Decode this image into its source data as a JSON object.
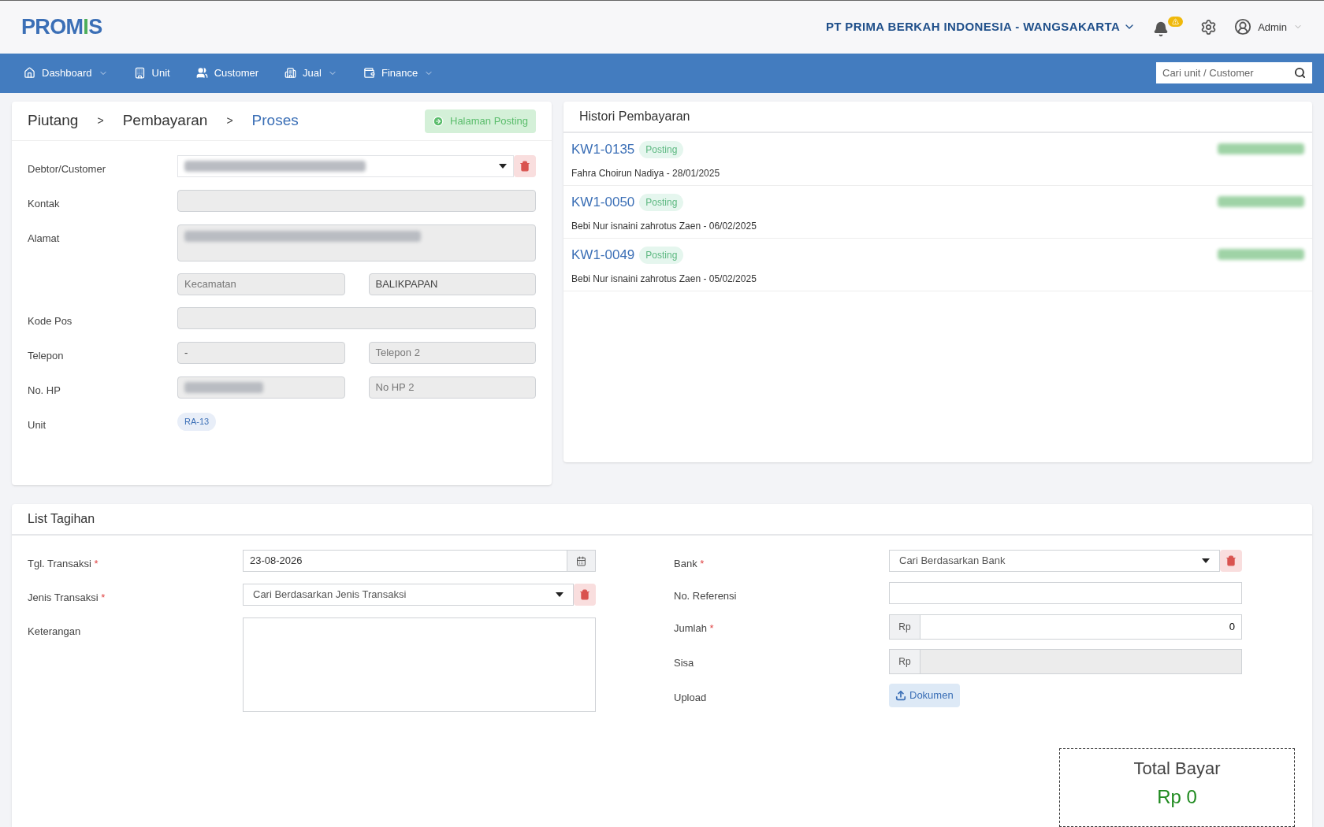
{
  "logo": {
    "segments": [
      {
        "text": "PROM",
        "color": "#3b6fb6"
      },
      {
        "text": "I",
        "color": "#4cae5a"
      },
      {
        "text": "S",
        "color": "#3b6fb6"
      }
    ]
  },
  "company": "PT PRIMA BERKAH INDONESIA - WANGSAKARTA",
  "user": "Admin",
  "nav": [
    {
      "label": "Dashboard",
      "dropdown": true
    },
    {
      "label": "Unit",
      "dropdown": false
    },
    {
      "label": "Customer",
      "dropdown": false
    },
    {
      "label": "Jual",
      "dropdown": true
    },
    {
      "label": "Finance",
      "dropdown": true
    }
  ],
  "search": {
    "placeholder": "Cari unit / Customer"
  },
  "breadcrumb": [
    {
      "label": "Piutang",
      "selected": false
    },
    {
      "label": "Pembayaran",
      "selected": false
    },
    {
      "label": "Proses",
      "selected": true
    }
  ],
  "breadcrumb_separator": ">",
  "posting_button": "Halaman Posting",
  "customer_form": [
    {
      "kind": "select",
      "label": "Debtor/Customer",
      "redacted": true
    },
    {
      "kind": "input",
      "label": "Kontak"
    },
    {
      "kind": "textarea",
      "label": "Alamat",
      "redacted": true
    },
    {
      "kind": "pair",
      "fields": [
        {
          "placeholder": "Kecamatan"
        },
        {
          "value": "BALIKPAPAN"
        }
      ]
    },
    {
      "kind": "input",
      "label": "Kode Pos"
    },
    {
      "kind": "pair",
      "label": "Telepon",
      "fields": [
        {
          "value": "-"
        },
        {
          "placeholder": "Telepon 2"
        }
      ]
    },
    {
      "kind": "pair",
      "label": "No. HP",
      "fields": [
        {
          "redacted": true
        },
        {
          "placeholder": "No HP 2"
        }
      ]
    },
    {
      "kind": "badge",
      "label": "Unit",
      "value": "RA-13"
    }
  ],
  "history": {
    "title": "Histori Pembayaran",
    "items": [
      {
        "code": "KW1-0135",
        "status": "Posting",
        "detail": "Fahra Choirun Nadiya - 28/01/2025",
        "amount_redacted": true
      },
      {
        "code": "KW1-0050",
        "status": "Posting",
        "detail": "Bebi Nur isnaini zahrotus Zaen - 06/02/2025",
        "amount_redacted": true
      },
      {
        "code": "KW1-0049",
        "status": "Posting",
        "detail": "Bebi Nur isnaini zahrotus Zaen - 05/02/2025",
        "amount_redacted": true
      }
    ]
  },
  "billing": {
    "title": "List Tagihan",
    "required_mark": "*",
    "left": [
      {
        "kind": "date",
        "label": "Tgl. Transaksi",
        "required": true,
        "value": "23-08-2026"
      },
      {
        "kind": "select",
        "label": "Jenis Transaksi",
        "required": true,
        "placeholder": "Cari Berdasarkan Jenis Transaksi"
      },
      {
        "kind": "textarea",
        "label": "Keterangan",
        "required": false
      }
    ],
    "right": [
      {
        "kind": "select",
        "label": "Bank",
        "required": true,
        "placeholder": "Cari Berdasarkan Bank"
      },
      {
        "kind": "input",
        "label": "No. Referensi",
        "required": false
      },
      {
        "kind": "currency",
        "label": "Jumlah",
        "required": true,
        "prefix": "Rp",
        "value": "0",
        "disabled": false
      },
      {
        "kind": "currency",
        "label": "Sisa",
        "required": false,
        "prefix": "Rp",
        "disabled": true
      },
      {
        "kind": "upload",
        "label": "Upload",
        "required": false,
        "button": "Dokumen"
      }
    ],
    "total": {
      "label": "Total Bayar",
      "value": "Rp 0"
    }
  }
}
